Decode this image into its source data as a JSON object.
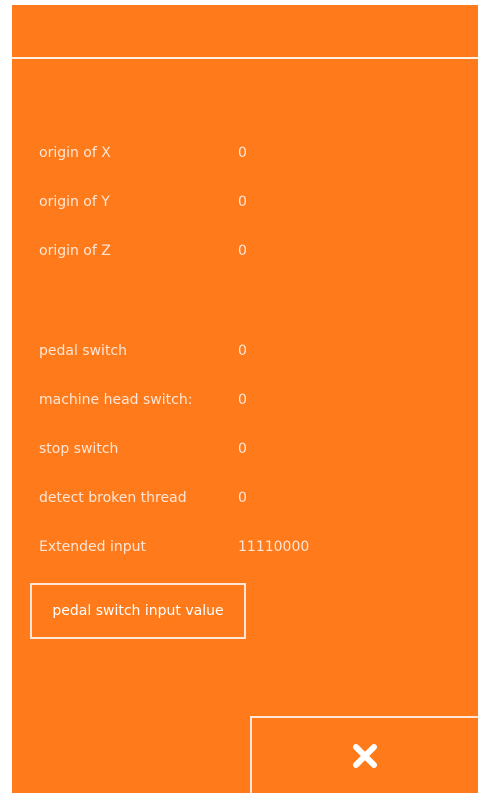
{
  "rows": [
    {
      "label": "origin of X",
      "value": "0"
    },
    {
      "label": "origin of Y",
      "value": "0"
    },
    {
      "label": "origin of Z",
      "value": "0"
    },
    {
      "label": "pedal switch",
      "value": "0"
    },
    {
      "label": "machine head switch:",
      "value": "0"
    },
    {
      "label": "stop switch",
      "value": "0"
    },
    {
      "label": "detect broken thread",
      "value": "0"
    },
    {
      "label": "Extended input",
      "value": "11110000"
    }
  ],
  "buttons": {
    "pedal_input": "pedal switch input value",
    "close_icon": "close-icon"
  },
  "colors": {
    "background": "#ff7a1a",
    "text": "#ffe6d6",
    "lines": "#fff1e6"
  }
}
